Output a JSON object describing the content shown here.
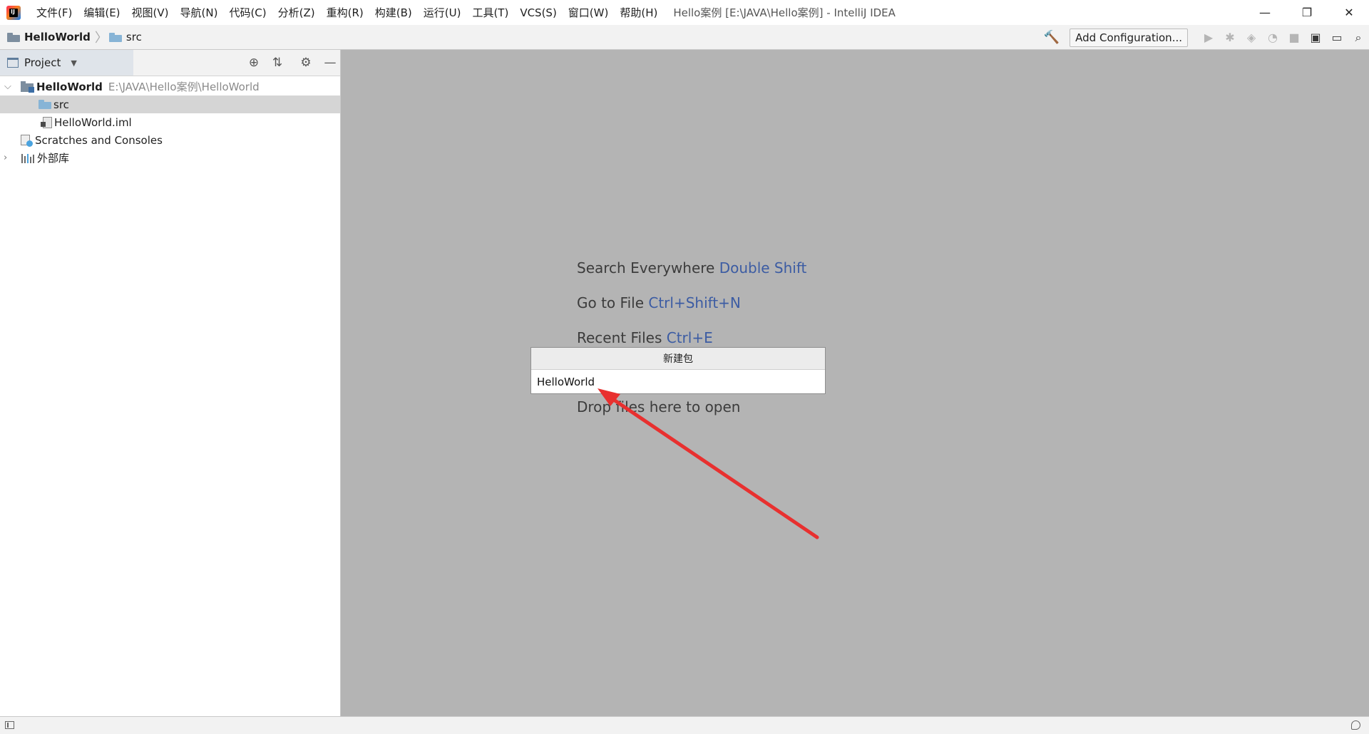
{
  "titlebar": {
    "logo_text": "IJ",
    "menus": [
      "文件(F)",
      "编辑(E)",
      "视图(V)",
      "导航(N)",
      "代码(C)",
      "分析(Z)",
      "重构(R)",
      "构建(B)",
      "运行(U)",
      "工具(T)",
      "VCS(S)",
      "窗口(W)",
      "帮助(H)"
    ],
    "window_title": "Hello案例 [E:\\JAVA\\Hello案例] - IntelliJ IDEA",
    "minimize": "—",
    "restore": "❐",
    "close": "✕"
  },
  "navbar": {
    "breadcrumb": [
      "HelloWorld",
      "src"
    ],
    "add_configuration": "Add Configuration...",
    "icon_color_module": "#7d8e9f",
    "icon_color_src": "#87b4d6"
  },
  "project": {
    "title": "Project",
    "tree": [
      {
        "label": "HelloWorld",
        "path": "E:\\JAVA\\Hello案例\\HelloWorld"
      },
      {
        "label": "src"
      },
      {
        "label": "HelloWorld.iml"
      },
      {
        "label": "Scratches and Consoles"
      },
      {
        "label": "外部库"
      }
    ]
  },
  "editor": {
    "hints": [
      {
        "text": "Search Everywhere",
        "key": "Double Shift"
      },
      {
        "text": "Go to File",
        "key": "Ctrl+Shift+N"
      },
      {
        "text": "Recent Files",
        "key": "Ctrl+E"
      },
      {
        "text": "Drop files here to open",
        "key": ""
      }
    ]
  },
  "popup": {
    "title": "新建包",
    "value": "HelloWorld"
  },
  "colors": {
    "editor_bg": "#b4b4b4",
    "shortcut": "#3c5ca3",
    "arrow": "#e8302f"
  }
}
